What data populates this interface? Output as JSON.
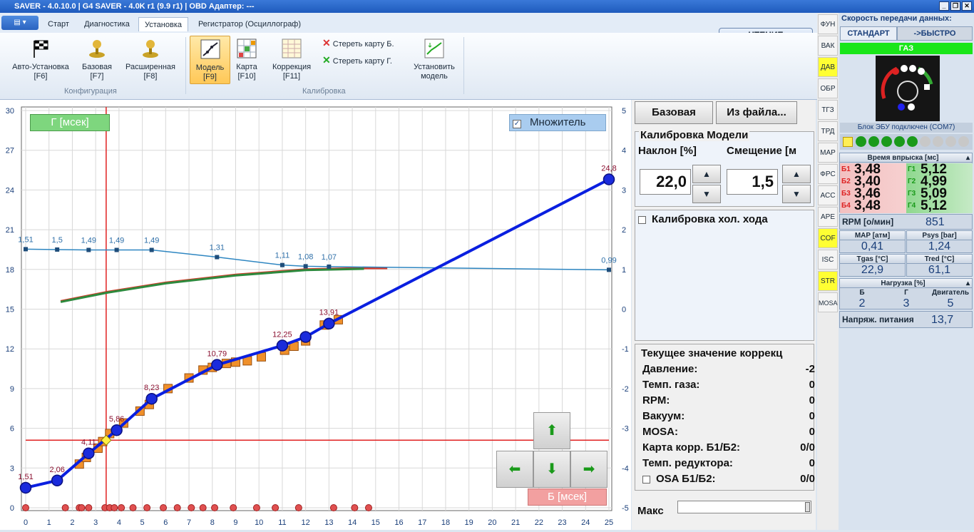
{
  "window": {
    "title": "SAVER - 4.0.10.0   |  G4 SAVER - 4.0K r1 (9.9 r1)  |  OBD Адаптер: ---"
  },
  "tabs": [
    "Старт",
    "Диагностика",
    "Установка",
    "Регистратор (Осциллограф)"
  ],
  "ribbon": {
    "config_buttons": [
      {
        "label": "Авто-Установка",
        "key": "[F6]"
      },
      {
        "label": "Базовая",
        "key": "[F7]"
      },
      {
        "label": "Расширенная",
        "key": "[F8]"
      }
    ],
    "config_group": "Конфигурация",
    "calib_buttons": [
      {
        "label": "Модель",
        "key": "[F9]"
      },
      {
        "label": "Карта",
        "key": "[F10]"
      },
      {
        "label": "Коррекция",
        "key": "[F11]"
      }
    ],
    "erase_b": "Стереть карту Б.",
    "erase_g": "Стереть карту Г.",
    "install_model": "Установить",
    "install_model2": "модель",
    "calib_group": "Калибровка",
    "read_button": "ЧТЕНИЕ"
  },
  "chart_ui": {
    "g_label": "Г [мсек]",
    "b_label": "Б [мсек]",
    "multiplier_label": "Множитель",
    "multiplier_checked": true
  },
  "chart_data": {
    "type": "line",
    "xlim": [
      0,
      25
    ],
    "ylim": [
      0,
      30
    ],
    "y2lim": [
      -5,
      5
    ],
    "x_ticks": [
      0,
      1,
      2,
      3,
      4,
      5,
      6,
      7,
      8,
      9,
      10,
      11,
      12,
      13,
      14,
      15,
      16,
      17,
      18,
      19,
      20,
      21,
      22,
      23,
      24,
      25
    ],
    "y_ticks": [
      0,
      3,
      6,
      9,
      12,
      15,
      18,
      21,
      24,
      27,
      30
    ],
    "y2_ticks": [
      -5,
      -4,
      -3,
      -2,
      -1,
      0,
      1,
      2,
      3,
      4,
      5
    ],
    "grid": true,
    "model_line": {
      "color": "#0a1fe0",
      "points": [
        [
          0,
          1.51
        ],
        [
          1.35,
          2.06
        ],
        [
          2.7,
          4.11
        ],
        [
          3.9,
          5.86
        ],
        [
          5.4,
          8.23
        ],
        [
          8.2,
          10.79
        ],
        [
          11,
          12.25
        ],
        [
          12,
          12.9
        ],
        [
          13,
          13.91
        ],
        [
          25,
          24.8
        ]
      ],
      "labels": [
        "1,51",
        "2,06",
        "4,11",
        "5,86",
        "8,23",
        "10,79",
        "12,25",
        "",
        "13,91",
        "24,8"
      ]
    },
    "multiplier_line": {
      "color": "#2e86c1",
      "points": [
        [
          0,
          1.51
        ],
        [
          1.35,
          1.5
        ],
        [
          2.7,
          1.49
        ],
        [
          3.9,
          1.49
        ],
        [
          5.4,
          1.49
        ],
        [
          8.2,
          1.31
        ],
        [
          11,
          1.11
        ],
        [
          12,
          1.08
        ],
        [
          13,
          1.07
        ],
        [
          25,
          0.99
        ]
      ],
      "labels": [
        "1,51",
        "1,5",
        "1,49",
        "1,49",
        "1,49",
        "1,31",
        "1,11",
        "1,08",
        "1,07",
        "0,99"
      ]
    },
    "measured_squares": [
      [
        2.3,
        3.3
      ],
      [
        2.6,
        3.8
      ],
      [
        3.1,
        4.5
      ],
      [
        3.3,
        5.0
      ],
      [
        3.6,
        5.6
      ],
      [
        4.2,
        6.4
      ],
      [
        4.9,
        7.3
      ],
      [
        5.3,
        7.8
      ],
      [
        6.1,
        9.0
      ],
      [
        7.0,
        9.8
      ],
      [
        7.6,
        10.4
      ],
      [
        8.0,
        10.6
      ],
      [
        8.6,
        10.9
      ],
      [
        9.0,
        11.0
      ],
      [
        9.5,
        11.1
      ],
      [
        10.1,
        11.4
      ],
      [
        11.1,
        11.9
      ],
      [
        11.5,
        12.2
      ],
      [
        12.0,
        12.6
      ],
      [
        12.8,
        13.8
      ],
      [
        13.4,
        14.2
      ]
    ],
    "corr_curve": [
      [
        1.5,
        15.6
      ],
      [
        3.5,
        16.3
      ],
      [
        6,
        17.0
      ],
      [
        9,
        17.6
      ],
      [
        12,
        18.0
      ],
      [
        14.5,
        18.1
      ],
      [
        15.5,
        18.1
      ]
    ],
    "zero_points": [
      0,
      1.7,
      2.3,
      2.4,
      2.7,
      3.4,
      3.6,
      3.8,
      4.1,
      4.6,
      5.2,
      5.9,
      6.5,
      7.1,
      7.6,
      8.1,
      8.9,
      9.9,
      10.7,
      11.7,
      13.2,
      14.1,
      14.7
    ],
    "crosshair": {
      "x": 3.45,
      "y": 5.1
    },
    "marker": {
      "x": 3.45,
      "y": 5.1
    }
  },
  "right_panel": {
    "btn_base": "Базовая",
    "btn_file": "Из файла...",
    "calib_title": "Калибровка Модели",
    "slope_label": "Наклон [%]",
    "offset_label": "Смещение [м",
    "slope_value": "22,0",
    "offset_value": "1,5",
    "idle_label": "Калибровка хол. хода",
    "corr_title": "Текущее значение коррекц",
    "corrections": [
      {
        "name": "Давление:",
        "value": "-2"
      },
      {
        "name": "Темп. газа:",
        "value": "0"
      },
      {
        "name": "RPM:",
        "value": "0"
      },
      {
        "name": "Вакуум:",
        "value": "0"
      },
      {
        "name": "MOSA:",
        "value": "0"
      },
      {
        "name": "Карта корр. Б1/Б2:",
        "value": "0/0"
      },
      {
        "name": "Темп. редуктора:",
        "value": "0"
      },
      {
        "name": "OSA Б1/Б2:",
        "value": "0/0"
      }
    ],
    "max_label": "Макс"
  },
  "vtabs": [
    "ФУН",
    "ВАК",
    "ДАВ",
    "ОБР",
    "ТГЗ",
    "ТРД",
    "МАР",
    "ФРС",
    "АСС",
    "АРЕ",
    "COF",
    "ISC",
    "STR",
    "MOSA"
  ],
  "vtabs_active": [
    "ДАВ",
    "COF",
    "STR"
  ],
  "sidebar": {
    "speed_title": "Скорость передачи данных:",
    "speed_std": "СТАНДАРТ",
    "speed_fast": "->БЫСТРО",
    "fuel": "ГАЗ",
    "ecu_status": "Блок ЭБУ подключен (COM7)",
    "inj_title": "Время впрыска [мс]",
    "injectors": [
      {
        "b_label": "Б1",
        "b": "3,48",
        "g_label": "Г1",
        "g": "5,12"
      },
      {
        "b_label": "Б2",
        "b": "3,40",
        "g_label": "Г2",
        "g": "4,99"
      },
      {
        "b_label": "Б3",
        "b": "3,46",
        "g_label": "Г3",
        "g": "5,09"
      },
      {
        "b_label": "Б4",
        "b": "3,48",
        "g_label": "Г4",
        "g": "5,12"
      }
    ],
    "rpm_label": "RPM [о/мин]",
    "rpm": "851",
    "map_label": "MAP [атм]",
    "map": "0,41",
    "psys_label": "Psys [bar]",
    "psys": "1,24",
    "tgas_label": "Tgas [°C]",
    "tgas": "22,9",
    "tred_label": "Tred [°C]",
    "tred": "61,1",
    "load_title": "Нагрузка [%]",
    "load_b_label": "Б",
    "load_b": "2",
    "load_g_label": "Г",
    "load_g": "3",
    "load_e_label": "Двигатель",
    "load_e": "5",
    "voltage_label": "Напряж. питания",
    "voltage": "13,7"
  }
}
